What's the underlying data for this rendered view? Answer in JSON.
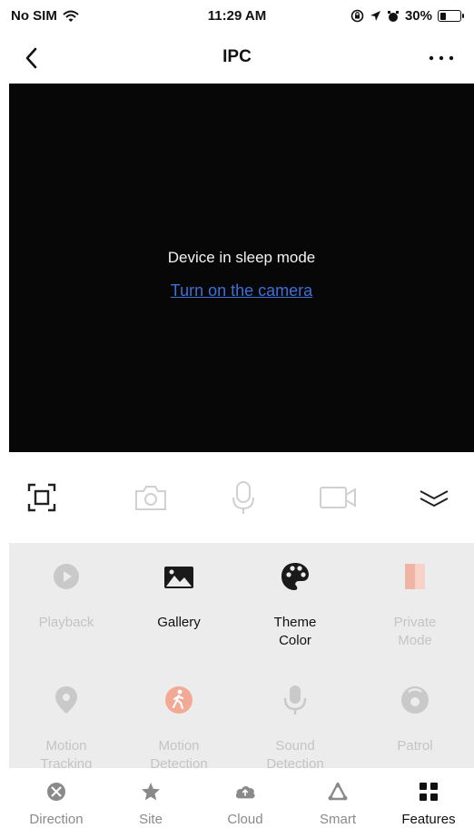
{
  "status_bar": {
    "carrier": "No SIM",
    "time": "11:29 AM",
    "battery_percent": "30%",
    "battery_level": 0.3
  },
  "header": {
    "title": "IPC"
  },
  "video": {
    "message": "Device in sleep mode",
    "action_link": "Turn on the camera"
  },
  "toolbar": {
    "icons": [
      "screen-fit-icon",
      "camera-snapshot-icon",
      "microphone-icon",
      "video-record-icon",
      "collapse-chevron-icon"
    ]
  },
  "features": [
    {
      "label": "Playback",
      "icon": "play-circle-icon",
      "enabled": false
    },
    {
      "label": "Gallery",
      "icon": "gallery-icon",
      "enabled": true
    },
    {
      "label": "Theme\nColor",
      "icon": "palette-icon",
      "enabled": true
    },
    {
      "label": "Private\nMode",
      "icon": "private-mode-icon",
      "enabled": false
    },
    {
      "label": "Motion\nTracking",
      "icon": "location-pin-icon",
      "enabled": false
    },
    {
      "label": "Motion\nDetection",
      "icon": "walking-person-icon",
      "enabled": false
    },
    {
      "label": "Sound\nDetection",
      "icon": "microphone-icon",
      "enabled": false
    },
    {
      "label": "Patrol",
      "icon": "patrol-icon",
      "enabled": false
    }
  ],
  "tabs": [
    {
      "label": "Direction",
      "icon": "direction-icon",
      "active": false
    },
    {
      "label": "Site",
      "icon": "star-icon",
      "active": false
    },
    {
      "label": "Cloud",
      "icon": "cloud-icon",
      "active": false
    },
    {
      "label": "Smart",
      "icon": "smart-icon",
      "active": false
    },
    {
      "label": "Features",
      "icon": "grid-icon",
      "active": true
    }
  ],
  "colors": {
    "link": "#3f6fd8",
    "disabled_icon": "#c9c9c9",
    "motion_detection_accent": "#f2a995",
    "private_mode_accent": "#f0b4a4"
  }
}
